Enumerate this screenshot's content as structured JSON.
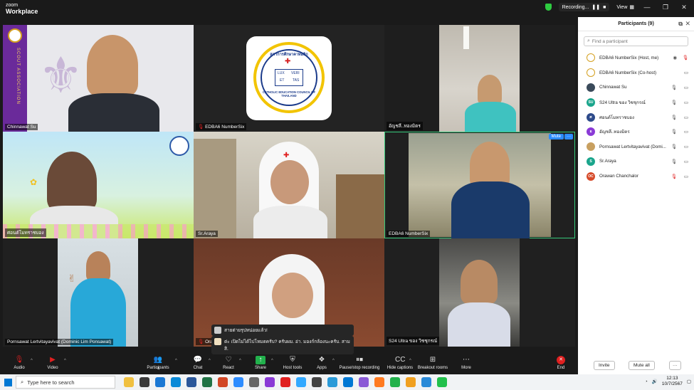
{
  "window": {
    "app_line1": "zoom",
    "app_line2": "Workplace",
    "recording_label": "Recording...",
    "view_label": "View"
  },
  "tiles": [
    {
      "name": "Chinnawat Su"
    },
    {
      "name": "EDBA6 NumberSix"
    },
    {
      "name": "อัญชลี..ทองมิตร"
    },
    {
      "name": "ศอนต์โมทราชบอง"
    },
    {
      "name": "Sr.Araya"
    },
    {
      "name": "EDBA6 NumberSix",
      "mute_label": "Mute",
      "more_label": "···"
    },
    {
      "name": "Pornsawat Lertvitayavivat (Dominic Lim Ponsawat)"
    },
    {
      "name": "Ora"
    },
    {
      "name": "S24 Ultra ของ วิชชุกรณ์"
    }
  ],
  "logo_texts": {
    "council_top": "สภาการศึกษาคาทอลิก",
    "council_bottom": "CATHOLIC EDUCATION COUNCIL OF THAILAND",
    "lux": "LUX",
    "veri": "VERI",
    "et": "ET",
    "tas": "TAS",
    "scout": "SCOUT ASSOCIATION"
  },
  "chat_toasts": [
    {
      "text": "สายต่ายรุปหน่อยแล้ว!"
    },
    {
      "text": "ต่ะ เปิดไม่ได้ไปโหมดครับ? ครับผม. อ่า. มองก์กล้องนะครับ. สามสิ."
    }
  ],
  "toolbar": {
    "audio": "Audio",
    "video": "Video",
    "participants": "Participants",
    "participants_count": "9",
    "chat": "Chat",
    "react": "React",
    "share": "Share",
    "host_tools": "Host tools",
    "apps": "Apps",
    "pause_recording": "Pause/stop recording",
    "hide_captions": "Hide captions",
    "breakout_rooms": "Breakout rooms",
    "more": "More",
    "end": "End"
  },
  "participants_panel": {
    "title": "Participants (9)",
    "search_placeholder": "Find a participant",
    "invite": "Invite",
    "mute_all": "Mute all",
    "more": "···",
    "items": [
      {
        "name": "EDBA6 NumberSix (Host, me)",
        "initials": "",
        "avatar_color": "#f5f0e6"
      },
      {
        "name": "EDBA6 NumberSix (Co-host)",
        "initials": "",
        "avatar_color": "#f5f0e6"
      },
      {
        "name": "Chinnawat Su",
        "initials": "",
        "avatar_color": "#3a4a5a"
      },
      {
        "name": "S24 Ultra ของ วิชชุกรณ์",
        "initials": "SU",
        "avatar_color": "#1aa58c"
      },
      {
        "name": "ศอนต์โมทราชบอง",
        "initials": "ศ",
        "avatar_color": "#2d4a8a"
      },
      {
        "name": "อัญชลี..ทองมิตร",
        "initials": "อ",
        "avatar_color": "#8a3ad6"
      },
      {
        "name": "Pornsawat Lertvitayavivat (Domi...",
        "initials": "",
        "avatar_color": "#c8a060"
      },
      {
        "name": "Sr.Araya",
        "initials": "S",
        "avatar_color": "#1aa58c"
      },
      {
        "name": "Orawan Chanchalor",
        "initials": "OC",
        "avatar_color": "#d64a2a"
      }
    ]
  },
  "taskbar": {
    "search_placeholder": "Type here to search",
    "time": "12:13",
    "date": "10/7/2567"
  }
}
